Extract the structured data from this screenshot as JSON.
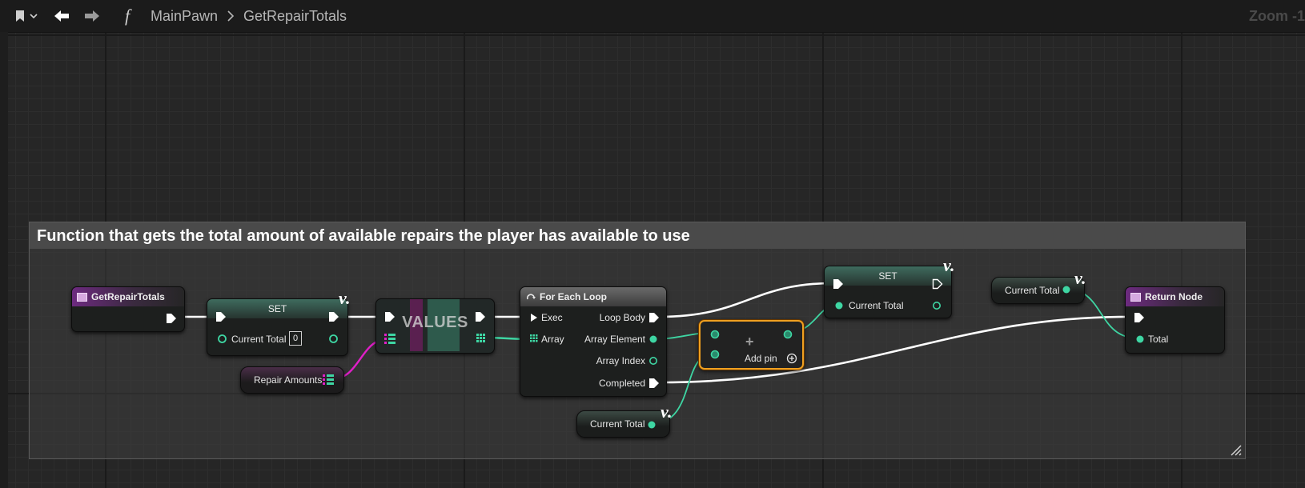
{
  "toolbar": {
    "breadcrumb_class": "MainPawn",
    "breadcrumb_function": "GetRepairTotals",
    "function_glyph": "f",
    "zoom": "Zoom -1",
    "icons": [
      "bookmark-icon",
      "chevron-down-icon",
      "back-arrow-icon",
      "forward-arrow-icon",
      "chevron-right-icon",
      "function-icon"
    ]
  },
  "comment": {
    "title": "Function that gets the total amount of available repairs the player has available to use"
  },
  "nodes": {
    "entry": {
      "title": "GetRepairTotals"
    },
    "set_current_total": {
      "title": "SET",
      "var": "Current Total",
      "default": "0"
    },
    "repair_amounts": {
      "label": "Repair Amounts"
    },
    "values": {
      "title": "VALUES"
    },
    "for_each": {
      "title": "For Each Loop",
      "exec": "Exec",
      "array": "Array",
      "loop_body": "Loop Body",
      "array_element": "Array Element",
      "array_index": "Array Index",
      "completed": "Completed"
    },
    "add": {
      "symbol": "+",
      "add_pin": "Add pin"
    },
    "set_result": {
      "title": "SET",
      "var": "Current Total"
    },
    "get_total_top": {
      "label": "Current Total"
    },
    "get_total_bottom": {
      "label": "Current Total"
    },
    "return": {
      "title": "Return Node",
      "output": "Total"
    }
  },
  "colors": {
    "float_pin": "#3ed6a3",
    "map_pin": "#e01fc8",
    "exec_pin": "#ffffff",
    "selected_outline": "#f0a020",
    "function_header": "#6d2a80"
  }
}
